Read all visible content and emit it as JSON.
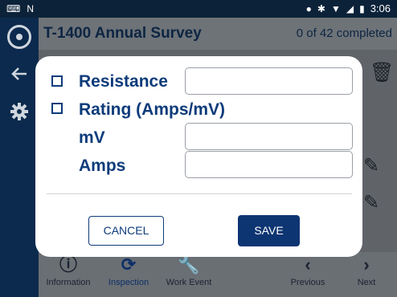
{
  "statusbar": {
    "left_icons": [
      "keyboard-icon",
      "n-icon"
    ],
    "right_icons": [
      "location-icon",
      "bluetooth-icon",
      "wifi-icon",
      "signal-icon",
      "battery-icon"
    ],
    "time": "3:06"
  },
  "rail": {
    "icons": [
      "app-logo-icon",
      "back-arrow-icon",
      "settings-gear-icon"
    ]
  },
  "header": {
    "title": "T-1400 Annual Survey",
    "progress": "0 of 42 completed"
  },
  "dialog": {
    "resistance_label": "Resistance",
    "resistance_value": "",
    "rating_label": "Rating (Amps/mV)",
    "mv_label": "mV",
    "mv_value": "",
    "amps_label": "Amps",
    "amps_value": "",
    "cancel_label": "CANCEL",
    "save_label": "SAVE"
  },
  "bottomnav": {
    "items": [
      {
        "label": "Information",
        "icon": "info-icon"
      },
      {
        "label": "Inspection",
        "icon": "inspection-icon",
        "active": true
      },
      {
        "label": "Work Event",
        "icon": "wrench-icon"
      },
      {
        "label": "Previous",
        "icon": "chevron-left-icon"
      },
      {
        "label": "Next",
        "icon": "chevron-right-icon"
      }
    ]
  },
  "colors": {
    "primary": "#0d3b7a",
    "statusbar": "#0b2239",
    "rail": "#0c2a4d"
  }
}
